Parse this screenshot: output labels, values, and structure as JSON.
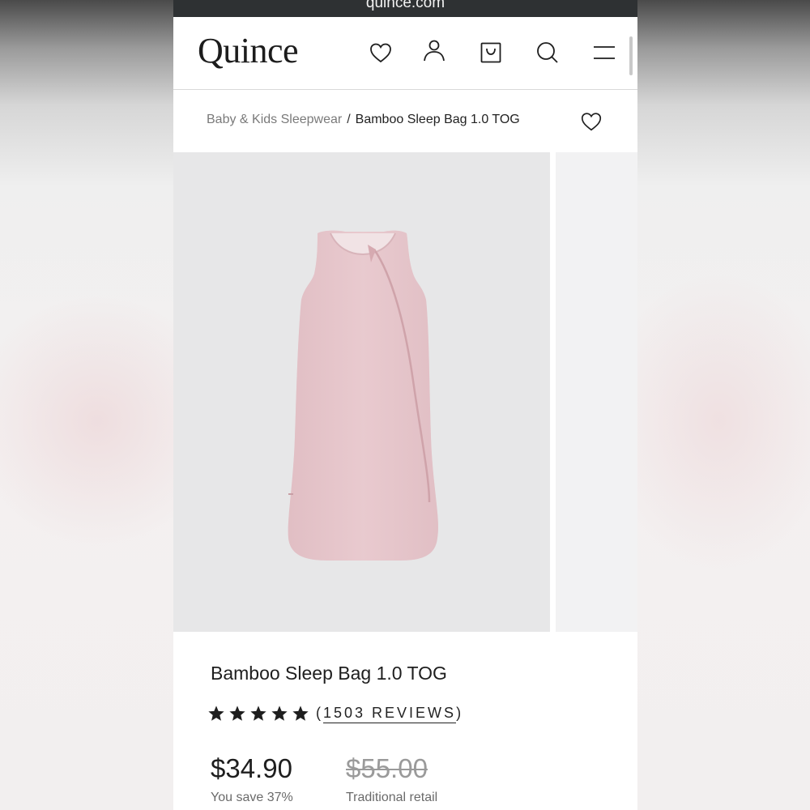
{
  "browser": {
    "url_text": "quince.com"
  },
  "header": {
    "logo": "Quince",
    "icons": [
      "heart-icon",
      "account-icon",
      "bag-icon",
      "search-icon",
      "menu-icon"
    ]
  },
  "breadcrumb": {
    "parent": "Baby & Kids Sleepwear",
    "separator": "/",
    "current": "Bamboo Sleep Bag 1.0 TOG"
  },
  "product": {
    "title": "Bamboo Sleep Bag 1.0 TOG",
    "rating": {
      "stars": 5,
      "reviews_open": "(",
      "reviews_label": "1503 REVIEWS",
      "reviews_close": ")"
    },
    "price": "$34.90",
    "savings": "You save 37%",
    "retail_price": "$55.00",
    "retail_label": "Traditional retail",
    "image_color": "#e8c8cd"
  }
}
